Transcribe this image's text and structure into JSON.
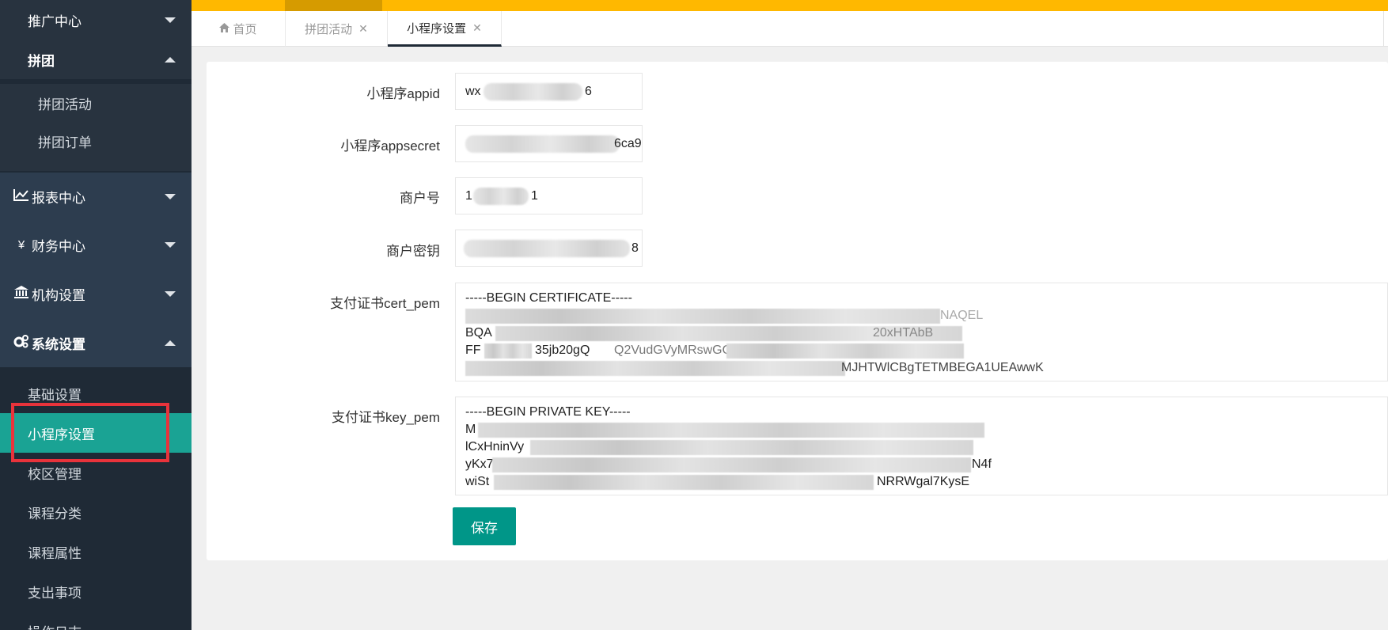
{
  "sidebar": {
    "items": [
      {
        "label": "推广中心",
        "expanded": false
      },
      {
        "label": "拼团",
        "expanded": true
      },
      {
        "label": "拼团活动"
      },
      {
        "label": "拼团订单"
      },
      {
        "label": "报表中心",
        "icon": "chart-line-icon",
        "expanded": false
      },
      {
        "label": "财务中心",
        "icon": "yen-icon",
        "expanded": false
      },
      {
        "label": "机构设置",
        "icon": "bank-icon",
        "expanded": false
      },
      {
        "label": "系统设置",
        "icon": "gears-icon",
        "expanded": true
      },
      {
        "label": "基础设置"
      },
      {
        "label": "小程序设置",
        "active": true
      },
      {
        "label": "校区管理"
      },
      {
        "label": "课程分类"
      },
      {
        "label": "课程属性"
      },
      {
        "label": "支出事项"
      },
      {
        "label": "操作日志"
      }
    ]
  },
  "tabs": [
    {
      "label": "首页",
      "icon": "home-icon"
    },
    {
      "label": "拼团活动",
      "closable": true
    },
    {
      "label": "小程序设置",
      "closable": true,
      "active": true
    }
  ],
  "form": {
    "appid": {
      "label": "小程序appid",
      "value_start": "wx",
      "value_end": "6"
    },
    "appsecret": {
      "label": "小程序appsecret",
      "value_end": "6ca9"
    },
    "mch_id": {
      "label": "商户号",
      "value_start": "1",
      "value_end": "1"
    },
    "mch_key": {
      "label": "商户密钥",
      "value_end": "8"
    },
    "cert_pem": {
      "label": "支付证书cert_pem",
      "lines": [
        "-----BEGIN CERTIFICATE-----",
        "NAQEL",
        "BQA",
        "20xHTAbB",
        "FF",
        "35jb20gQ",
        "Q2VudGVyMRswGQYDV",
        "MJHTWlCBgTETMBEGA1UEAwwK"
      ]
    },
    "key_pem": {
      "label": "支付证书key_pem",
      "lines": [
        "-----BEGIN PRIVATE KEY-----",
        "M",
        "lCxHninVy",
        "yKx7",
        "N4f",
        "wiSt",
        "NRRWgal7KysE"
      ]
    },
    "save_label": "保存"
  }
}
